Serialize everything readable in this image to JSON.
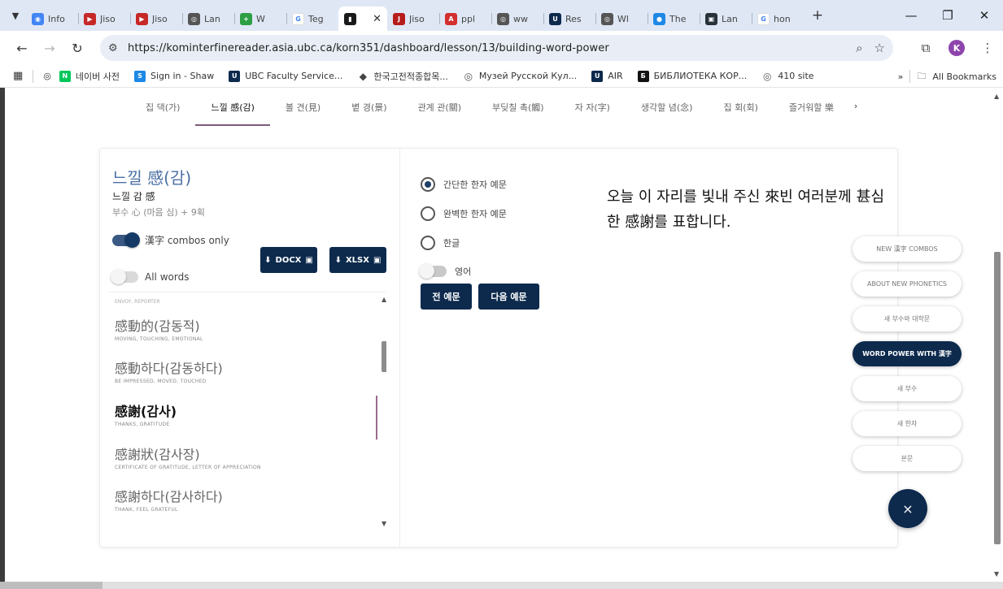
{
  "browser": {
    "tabs": [
      {
        "label": "Info",
        "icon": "globe-icon",
        "color": "#4285f4",
        "glyph": "◉"
      },
      {
        "label": "Jiso",
        "icon": "video-icon",
        "color": "#c62828",
        "glyph": "▶"
      },
      {
        "label": "Jiso",
        "icon": "video-icon",
        "color": "#c62828",
        "glyph": "▶"
      },
      {
        "label": "Lan",
        "icon": "globe-icon",
        "color": "#555555",
        "glyph": "◎"
      },
      {
        "label": "W",
        "icon": "plus-icon",
        "color": "#2e9e44",
        "glyph": "+"
      },
      {
        "label": "Teg",
        "icon": "google-icon",
        "color": "#ffffff",
        "glyph": "G"
      },
      {
        "label": "",
        "icon": "book-icon",
        "color": "#1a1a1a",
        "glyph": "▮",
        "active": true
      },
      {
        "label": "Jiso",
        "icon": "jstor-icon",
        "color": "#b71c1c",
        "glyph": "J"
      },
      {
        "label": "ppl",
        "icon": "pdf-icon",
        "color": "#d32f2f",
        "glyph": "A"
      },
      {
        "label": "ww",
        "icon": "globe-icon",
        "color": "#555555",
        "glyph": "◎"
      },
      {
        "label": "Res",
        "icon": "ubc-icon",
        "color": "#0d2a4d",
        "glyph": "U"
      },
      {
        "label": "Wl",
        "icon": "globe-icon",
        "color": "#555555",
        "glyph": "◎"
      },
      {
        "label": "The",
        "icon": "circle-icon",
        "color": "#1e88e5",
        "glyph": "●"
      },
      {
        "label": "Lan",
        "icon": "square-icon",
        "color": "#263238",
        "glyph": "▣"
      },
      {
        "label": "hon",
        "icon": "google-icon",
        "color": "#ffffff",
        "glyph": "G"
      }
    ],
    "close_glyph": "✕",
    "new_tab_glyph": "+",
    "url": "https://kominterfinereader.asia.ubc.ca/korn351/dashboard/lesson/13/building-word-power",
    "bookmarks": [
      {
        "label": "네이버 사전",
        "icon": "naver-icon",
        "color": "#03c75a",
        "glyph": "N"
      },
      {
        "label": "Sign in - Shaw",
        "icon": "shaw-icon",
        "color": "#1e88e5",
        "glyph": "S"
      },
      {
        "label": "UBC Faculty Service...",
        "icon": "ubc-icon",
        "color": "#0d2a4d",
        "glyph": "U"
      },
      {
        "label": "한국고전적종합목...",
        "icon": "map-pin-icon",
        "color": "#444444",
        "glyph": "◆"
      },
      {
        "label": "Музей Русской Кул...",
        "icon": "globe-icon",
        "color": "#555555",
        "glyph": "◎"
      },
      {
        "label": "AIR",
        "icon": "ubc-icon",
        "color": "#0d2a4d",
        "glyph": "U"
      },
      {
        "label": "БИБЛИОТЕКА КОР...",
        "icon": "library-icon",
        "color": "#111111",
        "glyph": "Б"
      },
      {
        "label": "410 site",
        "icon": "globe-icon",
        "color": "#555555",
        "glyph": "◎"
      }
    ],
    "all_bookmarks": "All Bookmarks",
    "profile_initial": "K"
  },
  "lesson_tabs": [
    "집 댁(가)",
    "느낄 感(감)",
    "볼 견(見)",
    "볕 경(景)",
    "관계 관(關)",
    "부딪칠 촉(觸)",
    "자 자(字)",
    "생각할 념(念)",
    "집 회(회)",
    "즐거워할 樂"
  ],
  "lesson_tabs_more": "›",
  "hanja": {
    "title": "느낄 感(감)",
    "subtitle": "느낄 감 感",
    "radical": "부수 心 (마음 심) + 9획"
  },
  "controls": {
    "combos_toggle_label": "漢字 combos only",
    "all_words_label": "All words",
    "docx_label": "DOCX",
    "xlsx_label": "XLSX"
  },
  "word_list": {
    "faded_top": "ENVOY, REPORTER",
    "items": [
      {
        "word": "感動的(감동적)",
        "gloss": "MOVING, TOUCHING, EMOTIONAL"
      },
      {
        "word": "感動하다(감동하다)",
        "gloss": "BE IMPRESSED, MOVED, TOUCHED"
      },
      {
        "word": "感謝(감사)",
        "gloss": "THANKS, GRATITUDE",
        "selected": true
      },
      {
        "word": "感謝狀(감사장)",
        "gloss": "CERTIFICATE OF GRATITUDE, LETTER OF APPRECIATION"
      },
      {
        "word": "感謝하다(감사하다)",
        "gloss": "THANK, FEEL GRATEFUL"
      }
    ]
  },
  "example_panel": {
    "radio_options": [
      {
        "label": "간단한 한자 예문",
        "checked": true
      },
      {
        "label": "완벽한 한자 예문",
        "checked": false
      },
      {
        "label": "한글",
        "checked": false
      }
    ],
    "english_toggle_label": "영어",
    "prev_button": "전 예문",
    "next_button": "다음 예문",
    "sentence": "오늘 이 자리를 빛내 주신 來빈 여러분께 甚심한 感謝를 표합니다."
  },
  "fab_menu": {
    "items": [
      {
        "label": "NEW 漢字 COMBOS"
      },
      {
        "label": "ABOUT NEW PHONETICS"
      },
      {
        "label": "새 부수와 대학문"
      },
      {
        "label": "WORD POWER WITH 漢字",
        "active": true
      },
      {
        "label": "새 부수"
      },
      {
        "label": "새 한자"
      },
      {
        "label": "본문"
      }
    ],
    "close_glyph": "×"
  }
}
